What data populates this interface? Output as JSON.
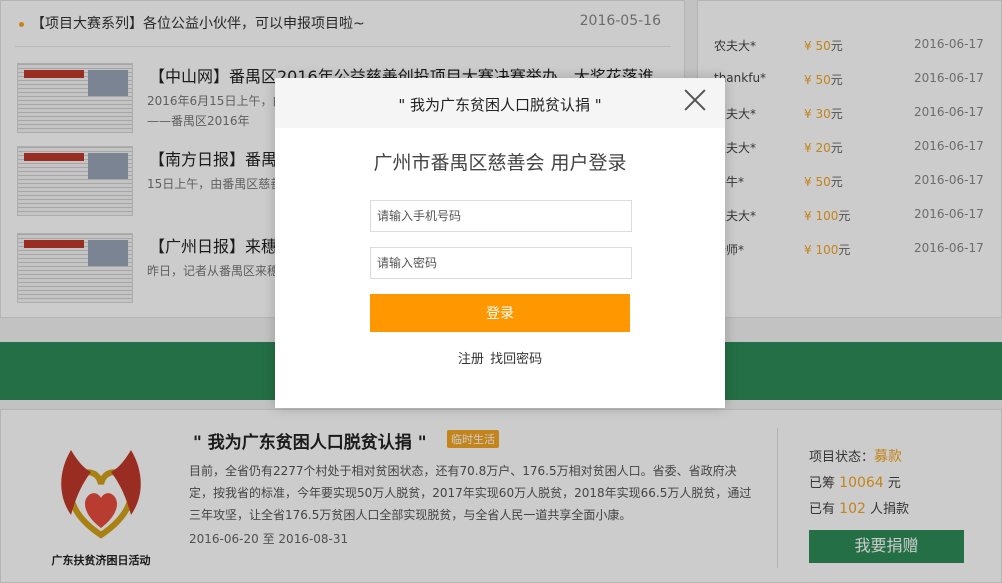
{
  "news": {
    "top": {
      "title": "【项目大赛系列】各位公益小伙伴，可以申报项目啦~",
      "date": "2016-05-16"
    },
    "items": [
      {
        "title": "【中山网】番禺区2016年公益慈善创投项目大赛决赛举办，大奖花落谁",
        "summary": "2016年6月15日上午，由番禺区慈善会主办的番禺区2016年公益慈善创投项目大赛决赛，共赢——番禺区2016年"
      },
      {
        "title": "【南方日报】番禺",
        "summary": "15日上午，由番禺区慈善会主办的番禺区2016年公益慈善创投项目大赛决赛在"
      },
      {
        "title": "【广州日报】来穗",
        "summary": "昨日，记者从番禺区来穗... 善会来穗务工人员重大疾"
      }
    ]
  },
  "donors": [
    {
      "name": "农夫大*",
      "amount": "50",
      "unit": "元",
      "date": "2016-06-17"
    },
    {
      "name": "thankfu*",
      "amount": "50",
      "unit": "元",
      "date": "2016-06-17"
    },
    {
      "name": "农夫大*",
      "amount": "30",
      "unit": "元",
      "date": "2016-06-17"
    },
    {
      "name": "农夫大*",
      "amount": "20",
      "unit": "元",
      "date": "2016-06-17"
    },
    {
      "name": "牛牛*",
      "amount": "50",
      "unit": "元",
      "date": "2016-06-17"
    },
    {
      "name": "农夫大*",
      "amount": "100",
      "unit": "元",
      "date": "2016-06-17"
    },
    {
      "name": "老师*",
      "amount": "100",
      "unit": "元",
      "date": "2016-06-17"
    }
  ],
  "currency_symbol": "¥",
  "project": {
    "title": "\" 我为广东贫困人口脱贫认捐 \"",
    "tag": "临时生活",
    "description": "目前，全省仍有2277个村处于相对贫困状态，还有70.8万户、176.5万相对贫困人口。省委、省政府决定，按我省的标准，今年要实现50万人脱贫，2017年实现60万人脱贫，2018年实现66.5万人脱贫，通过三年攻坚，让全省176.5万贫困人口全部实现脱贫，与全省人民一道共享全面小康。",
    "start_date": "2016-06-20",
    "date_sep": "至",
    "end_date": "2016-08-31",
    "logo_caption": "广东扶贫济困日活动",
    "status_label": "项目状态：",
    "status_value": "募款",
    "raised_prefix": "已筹",
    "raised_amount": "10064",
    "raised_suffix": "元",
    "donors_prefix": "已有",
    "donors_count": "102",
    "donors_suffix": "人捐款",
    "donate_button": "我要捐赠"
  },
  "modal": {
    "header": "\" 我为广东贫困人口脱贫认捐 \"",
    "title": "广州市番禺区慈善会 用户登录",
    "phone_placeholder": "请输入手机号码",
    "password_placeholder": "请输入密码",
    "login_button": "登录",
    "register_link": "注册",
    "recover_link": "找回密码"
  },
  "colors": {
    "accent": "#ff9800",
    "green": "#2e8b57",
    "amount": "#f5a623"
  }
}
